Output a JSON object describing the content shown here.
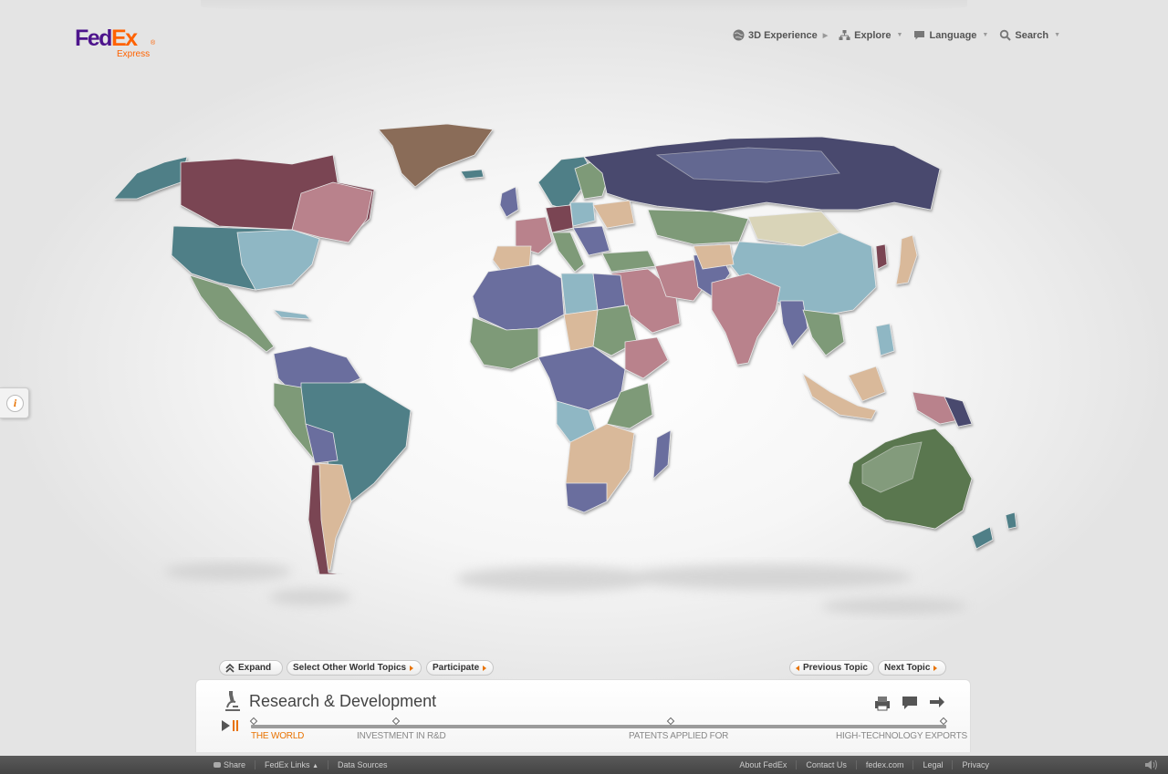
{
  "brand": {
    "name_part1": "Fed",
    "name_part2": "Ex",
    "sub": "Express",
    "purple": "#4d148c",
    "orange": "#ff6200"
  },
  "topnav": {
    "experience": "3D Experience",
    "explore": "Explore",
    "language": "Language",
    "search": "Search"
  },
  "info_tab": {
    "icon": "info-icon",
    "glyph": "i"
  },
  "controls": {
    "expand": "Expand",
    "select_topics": "Select Other World Topics",
    "participate": "Participate",
    "previous": "Previous Topic",
    "next": "Next Topic"
  },
  "topic": {
    "title": "Research & Development",
    "timeline": [
      "THE WORLD",
      "INVESTMENT IN R&D",
      "PATENTS APPLIED FOR",
      "HIGH-TECHNOLOGY EXPORTS"
    ],
    "active_index": 0
  },
  "footer": {
    "left": [
      "Share",
      "FedEx Links",
      "Data Sources"
    ],
    "right": [
      "About FedEx",
      "Contact Us",
      "fedex.com",
      "Legal",
      "Privacy"
    ]
  },
  "colors": {
    "teal": "#4f7f87",
    "maroon": "#7a4552",
    "rose": "#b9828c",
    "slate": "#6a6e9e",
    "sage": "#7e9a78",
    "tan": "#d9b99a",
    "lightblue": "#8fb7c4",
    "brown": "#8a6c58",
    "navy": "#484a6e",
    "green": "#5a7750"
  }
}
